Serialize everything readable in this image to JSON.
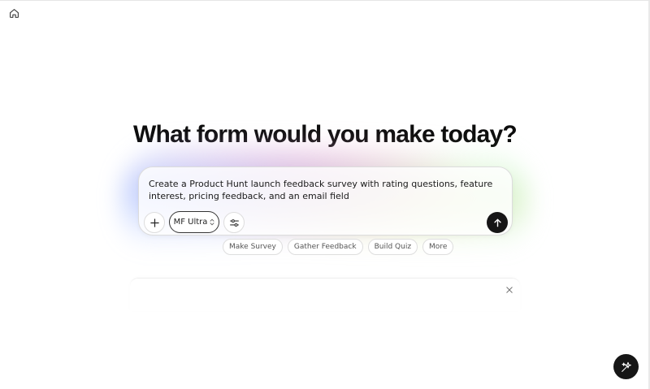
{
  "headline": "What form would you make today?",
  "prompt": {
    "value": "Create a Product Hunt launch feedback survey with rating questions, feature interest, pricing feedback, and an email field"
  },
  "toolbar": {
    "model_label": "MF Ultra",
    "model_chevron": "⌃⌄"
  },
  "suggestions": [
    {
      "label": "Make Survey"
    },
    {
      "label": "Gather Feedback"
    },
    {
      "label": "Build Quiz"
    },
    {
      "label": "More"
    }
  ],
  "icons": {
    "home": "home-icon",
    "plus": "plus-icon",
    "settings": "sliders-icon",
    "send": "arrow-up-icon",
    "close": "close-icon",
    "assistant": "sparkle-icon"
  },
  "colors": {
    "send_button": "#161616",
    "assistant_button": "#161616",
    "chip_border": "#dedede",
    "prompt_border": "#dcdcdc"
  }
}
